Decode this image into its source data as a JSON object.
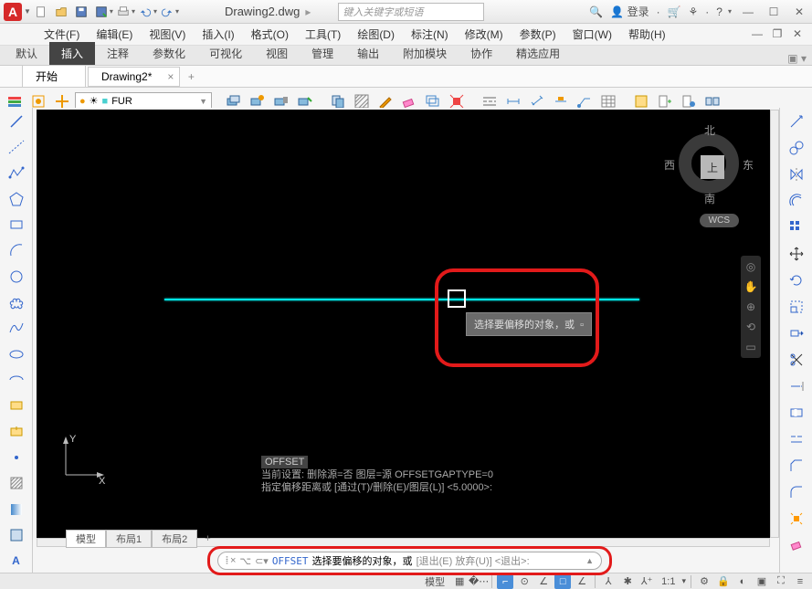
{
  "title": {
    "app_letter": "A",
    "document": "Drawing2.dwg",
    "search_placeholder": "键入关键字或短语",
    "login": "登录"
  },
  "menu": {
    "file": "文件(F)",
    "edit": "编辑(E)",
    "view": "视图(V)",
    "insert": "插入(I)",
    "format": "格式(O)",
    "tools": "工具(T)",
    "draw": "绘图(D)",
    "dimension": "标注(N)",
    "modify": "修改(M)",
    "params": "参数(P)",
    "window": "窗口(W)",
    "help": "帮助(H)"
  },
  "ribbon": {
    "default": "默认",
    "insert": "插入",
    "annotate": "注释",
    "parametric": "参数化",
    "viz": "可视化",
    "view": "视图",
    "manage": "管理",
    "output": "输出",
    "addons": "附加模块",
    "collab": "协作",
    "apps": "精选应用"
  },
  "doctabs": {
    "start": "开始",
    "drawing": "Drawing2*"
  },
  "layer": {
    "current": "FUR"
  },
  "compass": {
    "top": "上",
    "n": "北",
    "s": "南",
    "e": "东",
    "w": "西",
    "wcs": "WCS"
  },
  "tooltip": {
    "text": "选择要偏移的对象，或"
  },
  "cmd_history": {
    "tag": "OFFSET",
    "l1": "当前设置: 删除源=否  图层=源  OFFSETGAPTYPE=0",
    "l2": "指定偏移距离或 [通过(T)/删除(E)/图层(L)] <5.0000>:"
  },
  "cmd": {
    "keyword": "OFFSET",
    "prompt": "选择要偏移的对象，或",
    "opts": "[退出(E) 放弃(U)] <退出>:"
  },
  "layout": {
    "model": "模型",
    "l1": "布局1",
    "l2": "布局2"
  },
  "status": {
    "model": "模型",
    "scale": "1:1"
  },
  "ucs": {
    "x": "X",
    "y": "Y"
  }
}
